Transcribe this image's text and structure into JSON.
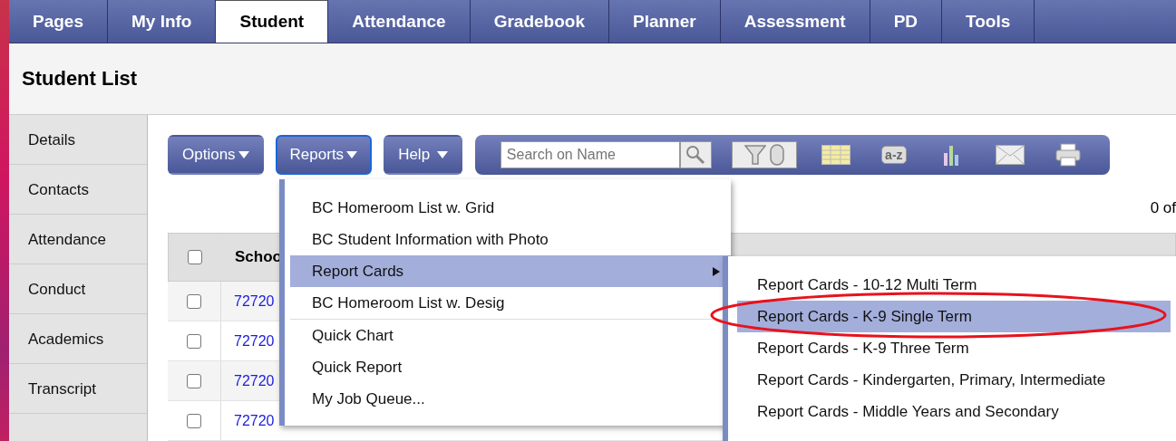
{
  "tabs": [
    {
      "label": "Pages",
      "selected": false
    },
    {
      "label": "My Info",
      "selected": false
    },
    {
      "label": "Student",
      "selected": true
    },
    {
      "label": "Attendance",
      "selected": false
    },
    {
      "label": "Gradebook",
      "selected": false
    },
    {
      "label": "Planner",
      "selected": false
    },
    {
      "label": "Assessment",
      "selected": false
    },
    {
      "label": "PD",
      "selected": false
    },
    {
      "label": "Tools",
      "selected": false
    }
  ],
  "page_title": "Student List",
  "sidebar": {
    "items": [
      {
        "label": "Details"
      },
      {
        "label": "Contacts"
      },
      {
        "label": "Attendance"
      },
      {
        "label": "Conduct"
      },
      {
        "label": "Academics"
      },
      {
        "label": "Transcript"
      }
    ]
  },
  "toolbar": {
    "buttons": [
      {
        "label": "Options",
        "focused": false
      },
      {
        "label": "Reports",
        "focused": true
      },
      {
        "label": "Help",
        "focused": false
      }
    ],
    "search": {
      "placeholder": "Search on Name"
    },
    "sort_label": "a-z"
  },
  "record_count": "0 of",
  "table": {
    "header_checked": false,
    "columns": [
      "Schoo"
    ],
    "rows": [
      {
        "checked": false,
        "column_1": "72720"
      },
      {
        "checked": false,
        "column_1": "72720"
      },
      {
        "checked": false,
        "column_1": "72720"
      },
      {
        "checked": false,
        "column_1": "72720"
      }
    ]
  },
  "reports_menu": {
    "items": [
      {
        "label": "BC Homeroom List w. Grid",
        "selected": false,
        "has_submenu": false,
        "separator_before": false
      },
      {
        "label": "BC Student Information with Photo",
        "selected": false,
        "has_submenu": false,
        "separator_before": false
      },
      {
        "label": "Report Cards",
        "selected": true,
        "has_submenu": true,
        "separator_before": false
      },
      {
        "label": "BC Homeroom List w. Desig",
        "selected": false,
        "has_submenu": false,
        "separator_before": false
      },
      {
        "label": "Quick Chart",
        "selected": false,
        "has_submenu": false,
        "separator_before": true
      },
      {
        "label": "Quick Report",
        "selected": false,
        "has_submenu": false,
        "separator_before": false
      },
      {
        "label": "My Job Queue...",
        "selected": false,
        "has_submenu": false,
        "separator_before": false
      }
    ]
  },
  "submenu": {
    "items": [
      {
        "label": "Report Cards - 10-12 Multi Term",
        "selected": false
      },
      {
        "label": "Report Cards - K-9 Single Term",
        "selected": true,
        "circled": true
      },
      {
        "label": "Report Cards - K-9 Three Term",
        "selected": false
      },
      {
        "label": "Report Cards - Kindergarten, Primary, Intermediate",
        "selected": false
      },
      {
        "label": "Report Cards - Middle Years and Secondary",
        "selected": false
      }
    ]
  }
}
